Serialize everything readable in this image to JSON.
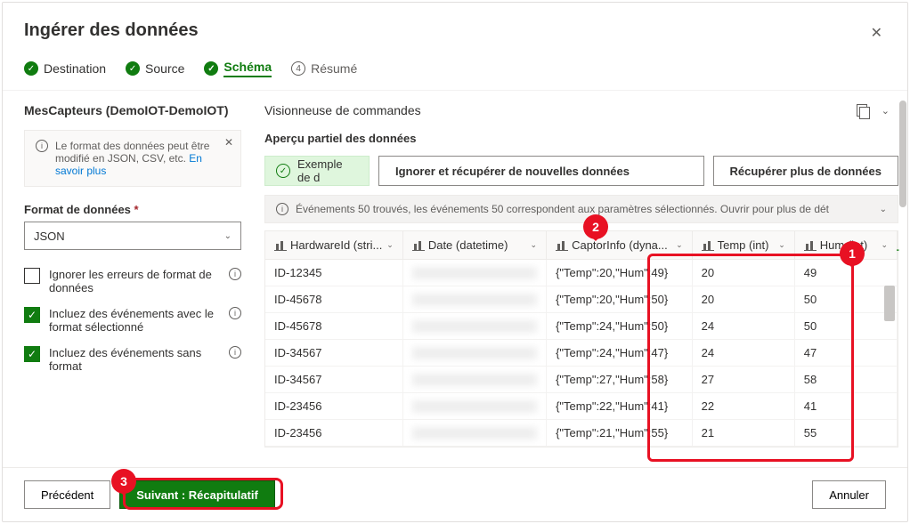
{
  "header": {
    "title": "Ingérer des données"
  },
  "steps": {
    "destination": "Destination",
    "source": "Source",
    "schema": "Schéma",
    "summary": "Résumé",
    "summary_num": "4"
  },
  "left": {
    "table_name": "MesCapteurs (DemoIOT-DemoIOT)",
    "notice": "Le format des données peut être modifié en JSON, CSV, etc.",
    "notice_link": "En savoir plus",
    "format_label": "Format de données",
    "format_value": "JSON",
    "cb_ignore": "Ignorer les erreurs de format de données",
    "cb_include_fmt": "Incluez des événements avec le format sélectionné",
    "cb_include_nofmt": "Incluez des événements sans format"
  },
  "right": {
    "viewer_title": "Visionneuse de commandes",
    "preview_title": "Aperçu partiel des données",
    "sample_label": "Exemple de d",
    "btn_ignore": "Ignorer et récupérer de nouvelles données",
    "btn_more": "Récupérer plus de données",
    "info_bar": "Événements 50 trouvés, les événements 50 correspondent aux paramètres sélectionnés. Ouvrir pour plus de dét",
    "cols": {
      "hw": "HardwareId (stri...",
      "dt": "Date (datetime)",
      "ci": "CaptorInfo (dyna...",
      "tp": "Temp (int)",
      "hm": "Hum (int)"
    },
    "rows": [
      {
        "hw": "ID-12345",
        "ci": "{\"Temp\":20,\"Hum\":49}",
        "tp": "20",
        "hm": "49"
      },
      {
        "hw": "ID-45678",
        "ci": "{\"Temp\":20,\"Hum\":50}",
        "tp": "20",
        "hm": "50"
      },
      {
        "hw": "ID-45678",
        "ci": "{\"Temp\":24,\"Hum\":50}",
        "tp": "24",
        "hm": "50"
      },
      {
        "hw": "ID-34567",
        "ci": "{\"Temp\":24,\"Hum\":47}",
        "tp": "24",
        "hm": "47"
      },
      {
        "hw": "ID-34567",
        "ci": "{\"Temp\":27,\"Hum\":58}",
        "tp": "27",
        "hm": "58"
      },
      {
        "hw": "ID-23456",
        "ci": "{\"Temp\":22,\"Hum\":41}",
        "tp": "22",
        "hm": "41"
      },
      {
        "hw": "ID-23456",
        "ci": "{\"Temp\":21,\"Hum\":55}",
        "tp": "21",
        "hm": "55"
      }
    ]
  },
  "footer": {
    "prev": "Précédent",
    "next": "Suivant : Récapitulatif",
    "cancel": "Annuler"
  },
  "annotations": {
    "a1": "1",
    "a2": "2",
    "a3": "3"
  }
}
